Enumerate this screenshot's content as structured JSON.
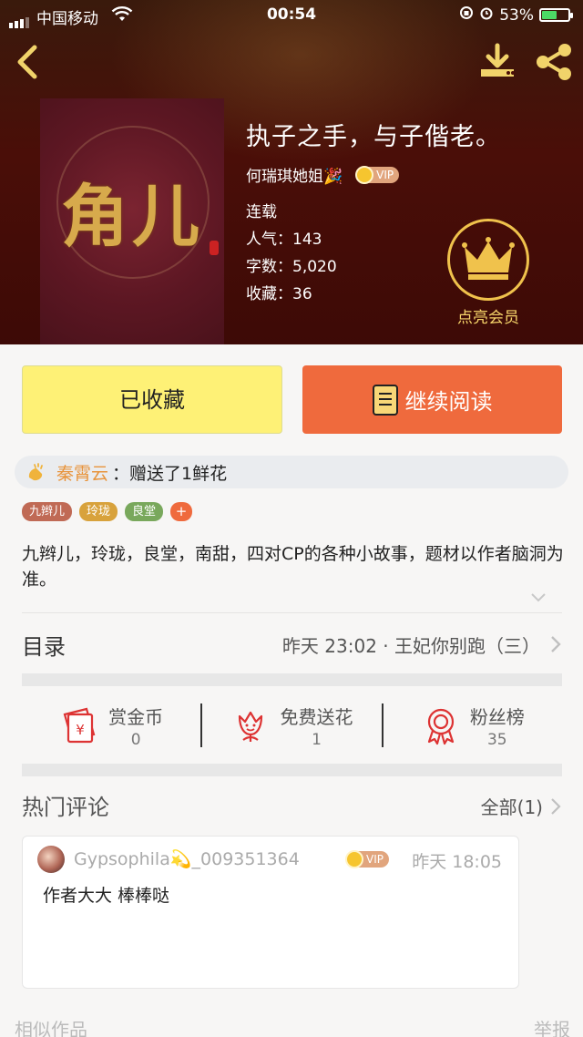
{
  "status_bar": {
    "carrier": "中国移动",
    "time": "00:54",
    "battery": "53%"
  },
  "book": {
    "cover_title": "角儿",
    "title": "执子之手，与子偕老。",
    "author": "何瑞琪她姐🎉",
    "vip_label": "VIP",
    "status": "连载",
    "popularity": "人气：143",
    "word_count": "字数：5,020",
    "favorites": "收藏：36"
  },
  "member": {
    "label": "点亮会员"
  },
  "actions": {
    "favorited_label": "已收藏",
    "continue_label": "继续阅读"
  },
  "gift": {
    "sender": "秦霄云",
    "text": "：赠送了1鲜花"
  },
  "tags": [
    {
      "label": "九辫儿",
      "color": "#c06a55"
    },
    {
      "label": "玲珑",
      "color": "#d8a23c"
    },
    {
      "label": "良堂",
      "color": "#79a85c"
    }
  ],
  "tag_add": "+",
  "description": "九辫儿，玲珑，良堂，南甜，四对CP的各种小故事，题材以作者脑洞为准。",
  "toc": {
    "label": "目录",
    "latest": "昨天 23:02 · 王妃你别跑（三）"
  },
  "stats": [
    {
      "name": "赏金币",
      "value": "0",
      "icon": "red-envelope-icon"
    },
    {
      "name": "免费送花",
      "value": "1",
      "icon": "flower-icon"
    },
    {
      "name": "粉丝榜",
      "value": "35",
      "icon": "medal-icon"
    }
  ],
  "comments_section": {
    "title": "热门评论",
    "all_link": "全部(1)"
  },
  "comment": {
    "username": "Gypsophila💫_009351364",
    "vip_label": "VIP",
    "time": "昨天 18:05",
    "text": "作者大大 棒棒哒"
  },
  "footer": {
    "similar": "相似作品",
    "report": "举报"
  },
  "colors": {
    "accent_orange": "#ef6a3d",
    "favorite_yellow": "#fef176",
    "gold": "#f0c24c"
  }
}
